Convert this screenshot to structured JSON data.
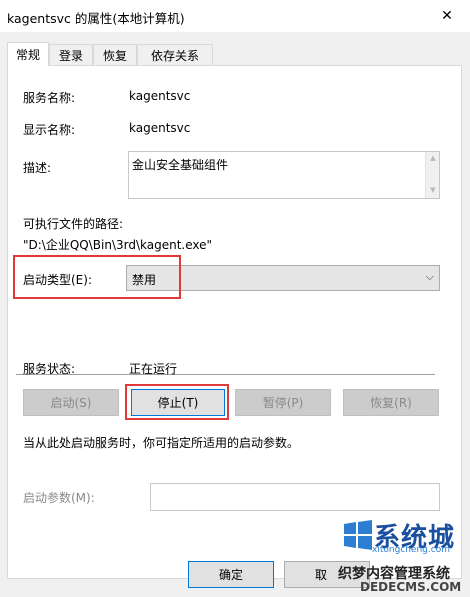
{
  "window": {
    "title": "kagentsvc 的属性(本地计算机)",
    "close_glyph": "✕"
  },
  "tabs": [
    {
      "label": "常规",
      "active": true
    },
    {
      "label": "登录",
      "active": false
    },
    {
      "label": "恢复",
      "active": false
    },
    {
      "label": "依存关系",
      "active": false
    }
  ],
  "general": {
    "service_name_label": "服务名称:",
    "service_name_value": "kagentsvc",
    "display_name_label": "显示名称:",
    "display_name_value": "kagentsvc",
    "description_label": "描述:",
    "description_value": "金山安全基础组件",
    "exe_path_label": "可执行文件的路径:",
    "exe_path_value": "\"D:\\企业QQ\\Bin\\3rd\\kagent.exe\"",
    "startup_type_label": "启动类型(E):",
    "startup_type_value": "禁用",
    "status_label": "服务状态:",
    "status_value": "正在运行",
    "buttons": {
      "start": "启动(S)",
      "stop": "停止(T)",
      "pause": "暂停(P)",
      "resume": "恢复(R)"
    },
    "hint": "当从此处启动服务时，你可指定所适用的启动参数。",
    "start_params_label": "启动参数(M):",
    "start_params_value": ""
  },
  "footer": {
    "ok": "确定",
    "cancel": "取"
  },
  "watermark": {
    "line1": "系统城",
    "line2": "xitongcheng.com",
    "line3": "织梦内容管理系统",
    "line4": "DEDECMS.COM"
  },
  "colors": {
    "highlight": "#e03a3a",
    "panel_bg": "#ffffff",
    "dialog_bg": "#f0f0f0",
    "focus_border": "#0078d7"
  },
  "icons": {
    "dropdown": "chevron-down-icon",
    "close": "close-icon",
    "watermark_logo": "windows-logo-icon"
  }
}
